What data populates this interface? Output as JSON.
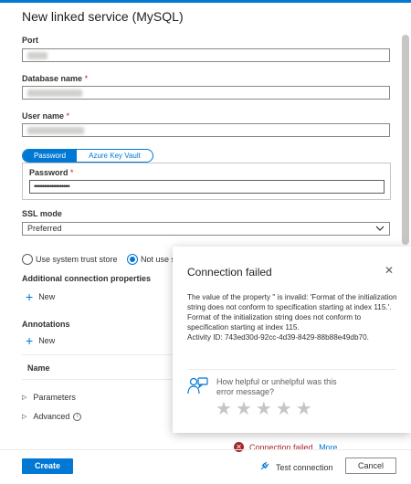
{
  "title": "New linked service (MySQL)",
  "fields": {
    "port_label": "Port",
    "database_label": "Database name",
    "user_label": "User name",
    "required_mark": "*",
    "password_label": "Password",
    "password_value": "••••••••••••••••••"
  },
  "auth_toggle": {
    "password": "Password",
    "akv": "Azure Key Vault"
  },
  "ssl": {
    "label": "SSL mode",
    "value": "Preferred"
  },
  "radios": {
    "system": "Use system trust store",
    "not_use": "Not use s"
  },
  "additional": {
    "heading": "Additional connection properties",
    "new": "New"
  },
  "annotations": {
    "heading": "Annotations",
    "new": "New",
    "name_col": "Name"
  },
  "expanders": {
    "parameters": "Parameters",
    "advanced": "Advanced"
  },
  "footer": {
    "create": "Create",
    "status": "Connection failed.",
    "more": "More",
    "test": "Test connection",
    "cancel": "Cancel"
  },
  "popup": {
    "title": "Connection failed",
    "body1": "The value of the property '' is invalid: 'Format of the initialization string does not conform to specification starting at index 115.'.",
    "body2": "Format of the initialization string does not conform to specification starting at index 115.",
    "body3": "Activity ID: 743ed30d-92cc-4d39-8429-88b88e49db70.",
    "feedback": "How helpful or unhelpful was this error message?"
  },
  "colors": {
    "accent": "#0078d4",
    "error": "#a4262c"
  }
}
